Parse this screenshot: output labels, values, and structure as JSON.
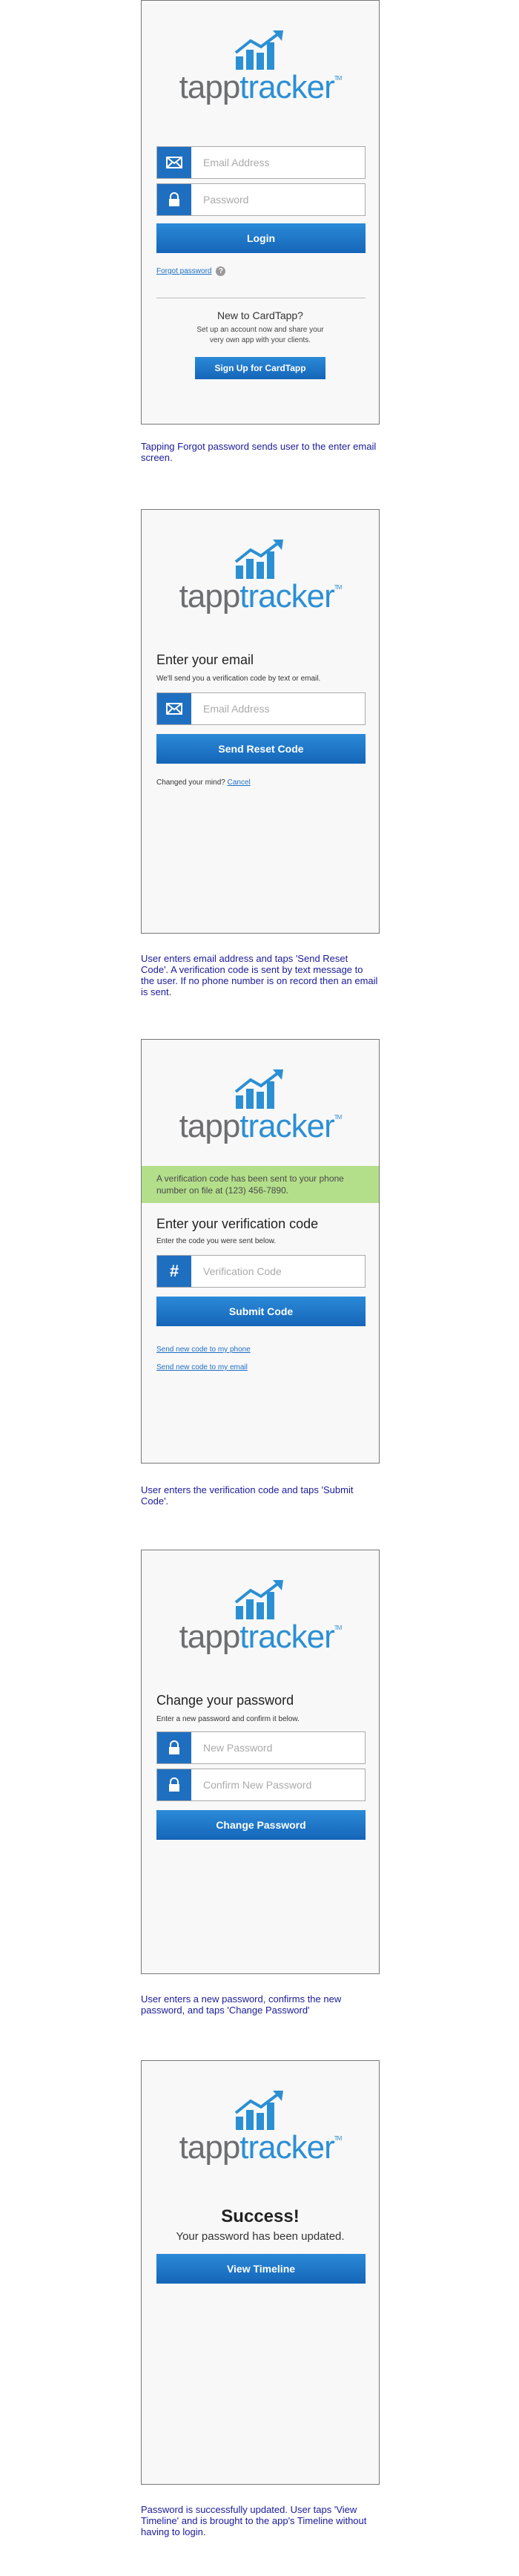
{
  "brand": {
    "tapp": "tapp",
    "tracker": "tracker",
    "tm": "TM",
    "accent": "#2b8fd4",
    "button_blue": "#1f6fc0"
  },
  "screen1": {
    "email_placeholder": "Email Address",
    "password_placeholder": "Password",
    "login_label": "Login",
    "forgot_label": "Forgot password",
    "new_heading": "New to CardTapp?",
    "new_text_1": "Set up an account now and share your",
    "new_text_2": "very own app with your clients.",
    "signup_label": "Sign Up for CardTapp"
  },
  "note1": "Tapping Forgot password sends user to the enter email screen.",
  "screen2": {
    "heading": "Enter your email",
    "sub": "We'll send you a verification code by text or email.",
    "email_placeholder": "Email Address",
    "send_label": "Send Reset Code",
    "changed_mind": "Changed your mind?",
    "cancel_label": "Cancel"
  },
  "note2": "User enters email address and taps 'Send Reset Code'. A verification code is sent by text message to the user. If no phone number is on record then an email is sent.",
  "screen3": {
    "banner": "A verification code has been sent to your phone number on file at (123) 456-7890.",
    "heading": "Enter your verification code",
    "sub": "Enter the code you were sent below.",
    "code_placeholder": "Verification Code",
    "submit_label": "Submit Code",
    "resend_phone": "Send new code to my phone",
    "resend_email": "Send new code to my email"
  },
  "note3": "User enters the verification code and taps 'Submit Code'.",
  "screen4": {
    "heading": "Change your password",
    "sub": "Enter a new password and confirm it below.",
    "new_placeholder": "New Password",
    "confirm_placeholder": "Confirm New Password",
    "change_label": "Change Password"
  },
  "note4": "User enters a new password, confirms the new password, and taps 'Change Password'",
  "screen5": {
    "title": "Success!",
    "sub": "Your password has been updated.",
    "timeline_label": "View Timeline"
  },
  "note5": "Password is successfully updated. User taps 'View Timeline' and is brought to the app's Timeline without having to login."
}
